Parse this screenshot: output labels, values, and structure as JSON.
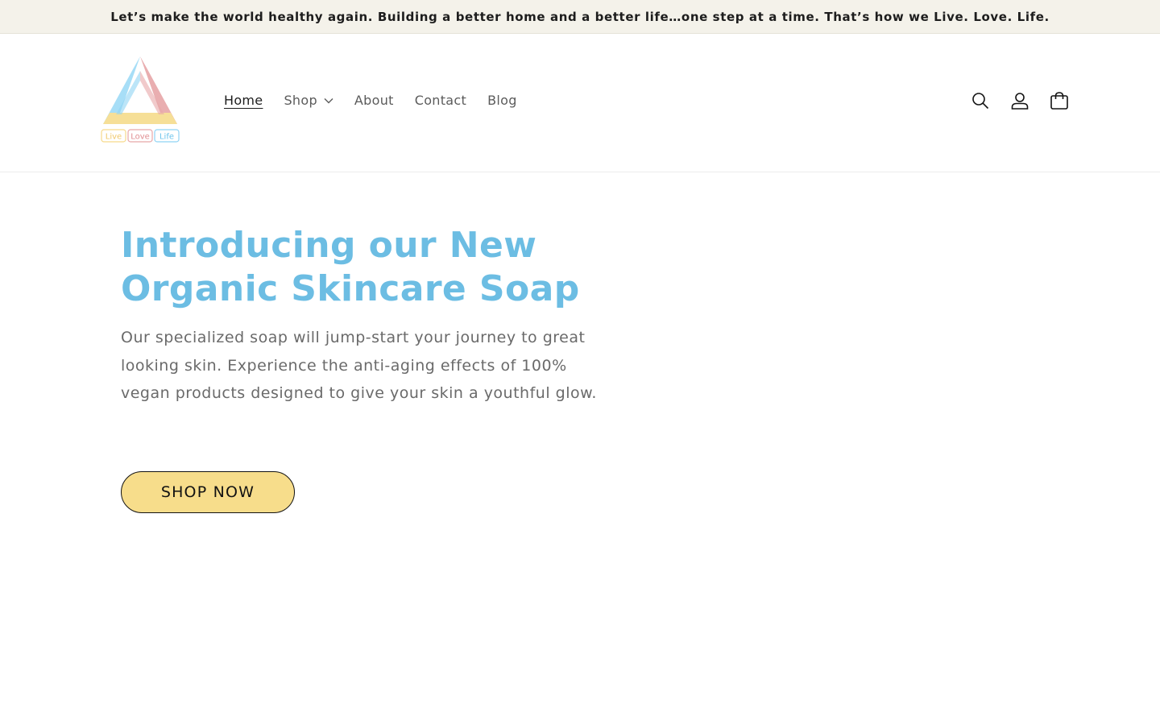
{
  "announcement": {
    "text": "Let’s make the world healthy again. Building a better home and a better life…one step at a time. That’s how we Live. Love. Life."
  },
  "logo": {
    "words": [
      "Live",
      "Love",
      "Life"
    ]
  },
  "nav": {
    "items": [
      {
        "label": "Home",
        "active": true
      },
      {
        "label": "Shop",
        "has_dropdown": true
      },
      {
        "label": "About"
      },
      {
        "label": "Contact"
      },
      {
        "label": "Blog"
      }
    ]
  },
  "header_icons": [
    "search-icon",
    "account-icon",
    "cart-icon"
  ],
  "hero": {
    "title": "Introducing our New Organic Skincare Soap",
    "description": "Our specialized soap will jump-start your journey to great looking skin. Experience the anti-aging effects of 100% vegan products designed to give your skin a youthful glow.",
    "cta_label": "SHOP NOW"
  },
  "colors": {
    "announcement_bg": "#f4f2ea",
    "title": "#6cbde3",
    "button_bg": "#f7dd8b",
    "logo_blue": "#8fd3f4",
    "logo_pink": "#e8a6a8",
    "logo_yellow": "#f7dd8b"
  }
}
